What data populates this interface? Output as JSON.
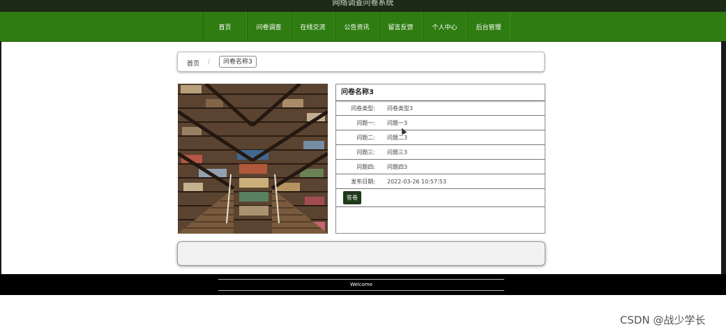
{
  "header": {
    "site_title": "网络调查问卷系统"
  },
  "nav": {
    "items": [
      "首页",
      "问卷调查",
      "在线交流",
      "公告资讯",
      "留言反馈",
      "个人中心",
      "后台管理"
    ]
  },
  "breadcrumb": {
    "home": "首页",
    "separator": "/",
    "current": "问卷名称3"
  },
  "detail": {
    "title": "问卷名称3",
    "fields": [
      {
        "label": "问卷类型:",
        "value": "问卷类型3"
      },
      {
        "label": "问题一:",
        "value": "问题一3"
      },
      {
        "label": "问题二:",
        "value": "问题二3"
      },
      {
        "label": "问题三:",
        "value": "问题三3"
      },
      {
        "label": "问题四:",
        "value": "问题四3"
      },
      {
        "label": "发布日期:",
        "value": "2022-03-26 10:57:53"
      }
    ],
    "answer_button": "答卷"
  },
  "footer": {
    "welcome": "Welcome"
  },
  "watermark": "CSDN @战少学长",
  "colors": {
    "nav_green": "#2f7d12",
    "button_dark": "#1d3a18",
    "footer_bg": "#000000"
  }
}
